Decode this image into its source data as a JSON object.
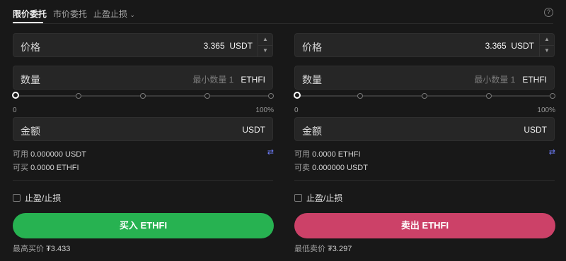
{
  "tabs": [
    {
      "label": "限价委托",
      "active": true
    },
    {
      "label": "市价委托",
      "active": false
    },
    {
      "label": "止盈止损",
      "active": false,
      "dropdown": true
    }
  ],
  "help_icon": "?",
  "colors": {
    "buy": "#27b251",
    "sell": "#cc4168",
    "swap": "#6f7fff"
  },
  "buy": {
    "price_label": "价格",
    "price_value": "3.365",
    "price_unit": "USDT",
    "qty_label": "数量",
    "qty_placeholder": "最小数量 1",
    "qty_unit": "ETHFI",
    "slider_min": "0",
    "slider_max": "100%",
    "slider_level": 0,
    "amount_label": "金额",
    "amount_unit": "USDT",
    "available_label": "可用",
    "available_value": "0.000000 USDT",
    "can_label": "可买",
    "can_value": "0.0000 ETHFI",
    "tpsl_label": "止盈/止损",
    "button_label": "买入 ETHFI",
    "best_label": "最高买价",
    "best_value": "₮3.433"
  },
  "sell": {
    "price_label": "价格",
    "price_value": "3.365",
    "price_unit": "USDT",
    "qty_label": "数量",
    "qty_placeholder": "最小数量 1",
    "qty_unit": "ETHFI",
    "slider_min": "0",
    "slider_max": "100%",
    "slider_level": 0,
    "amount_label": "金额",
    "amount_unit": "USDT",
    "available_label": "可用",
    "available_value": "0.0000 ETHFI",
    "can_label": "可卖",
    "can_value": "0.000000 USDT",
    "tpsl_label": "止盈/止损",
    "button_label": "卖出 ETHFI",
    "best_label": "最低卖价",
    "best_value": "₮3.297"
  }
}
